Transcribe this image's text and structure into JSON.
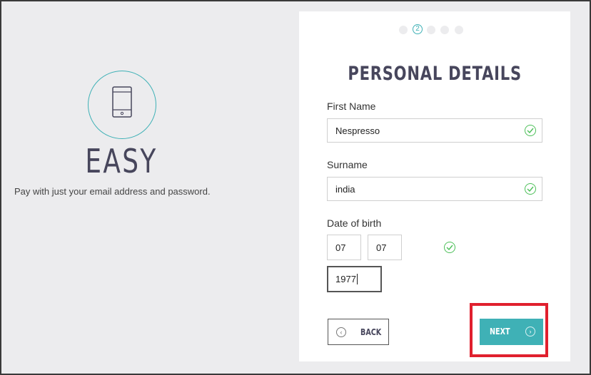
{
  "promo": {
    "icon": "smartphone-icon",
    "title": "EASY",
    "text": "Pay with just your email address and password."
  },
  "steps": {
    "current": "2",
    "total": 5
  },
  "form": {
    "title": "PERSONAL DETAILS",
    "first_name": {
      "label": "First Name",
      "value": "Nespresso"
    },
    "surname": {
      "label": "Surname",
      "value": "india"
    },
    "dob": {
      "label": "Date of birth",
      "day": "07",
      "month": "07",
      "year": "1977"
    },
    "back_label": "BACK",
    "next_label": "NEXT"
  },
  "colors": {
    "accent": "#3fb1b6",
    "valid": "#4cbf58",
    "title": "#47465c",
    "highlight": "#e0202e"
  }
}
